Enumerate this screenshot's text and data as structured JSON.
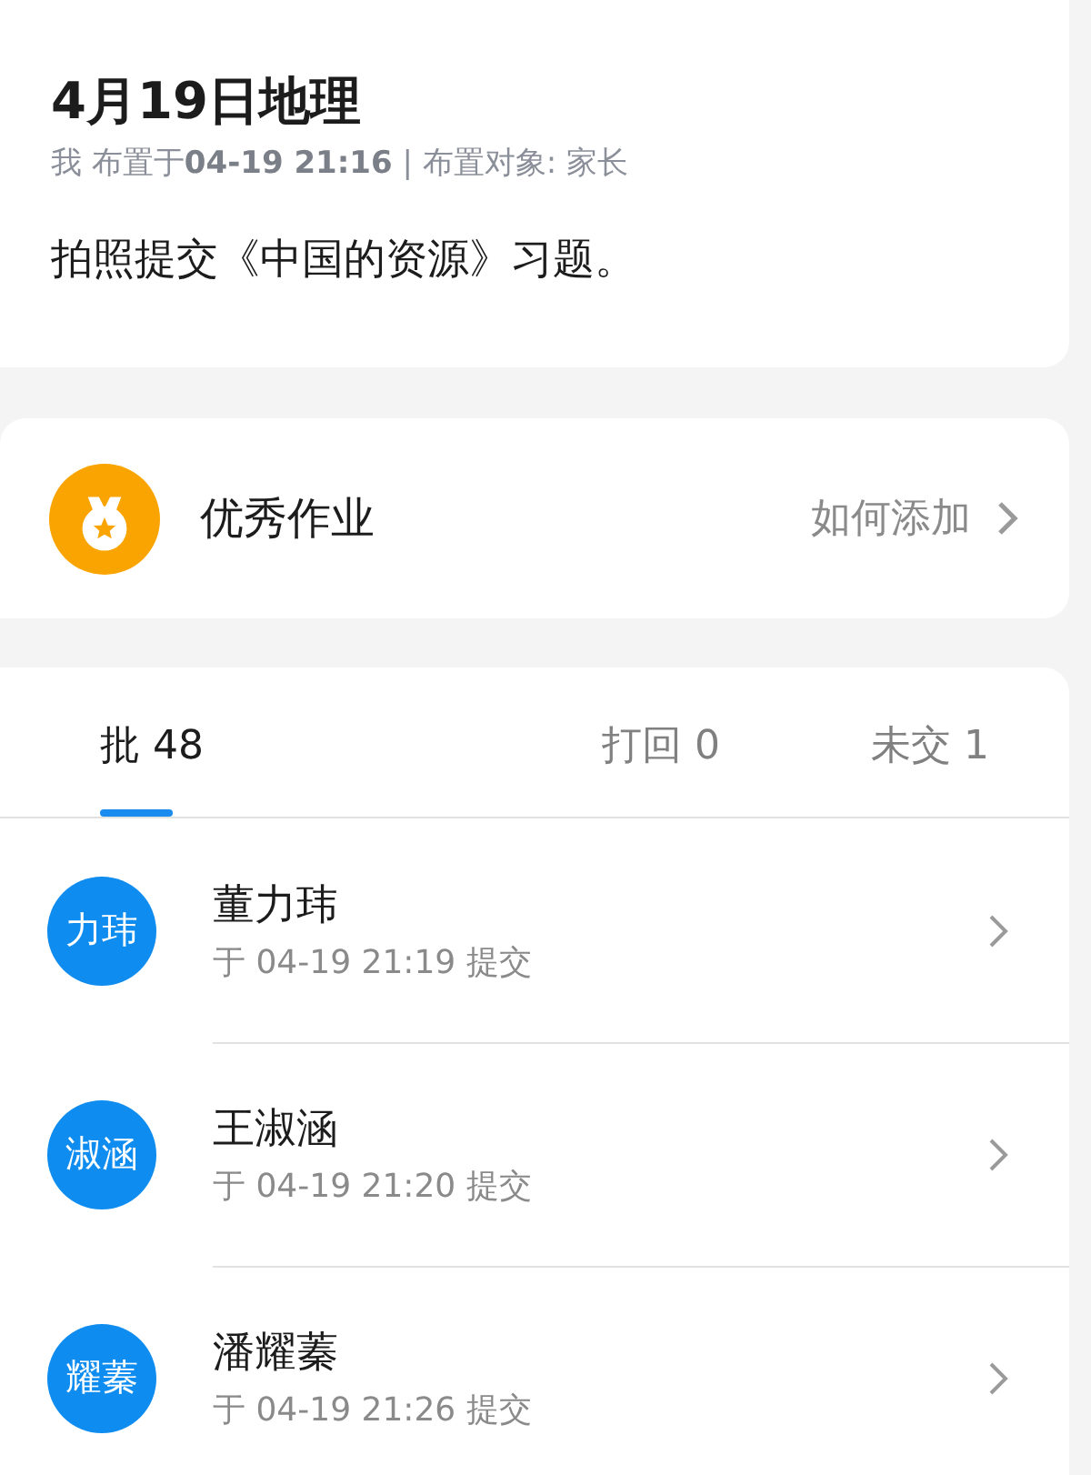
{
  "assignment": {
    "title": "4月19日地理",
    "meta": "我 布置于**04-19 21:16** | 布置对象: 家长",
    "description": "拍照提交《中国的资源》习题。"
  },
  "excellent": {
    "label": "优秀作业",
    "link": "如何添加"
  },
  "tabs": [
    {
      "label": "批 48",
      "selected": true
    },
    {
      "label": "打回 0",
      "selected": false
    },
    {
      "label": "未交 1",
      "selected": false
    }
  ],
  "submissions": [
    {
      "avatar": "力玮",
      "name": "董力玮",
      "time": "于 04-19 21:19 提交"
    },
    {
      "avatar": "淑涵",
      "name": "王淑涵",
      "time": "于 04-19 21:20 提交"
    },
    {
      "avatar": "耀蓁",
      "name": "潘耀蓁",
      "time": "于 04-19 21:26 提交"
    }
  ]
}
